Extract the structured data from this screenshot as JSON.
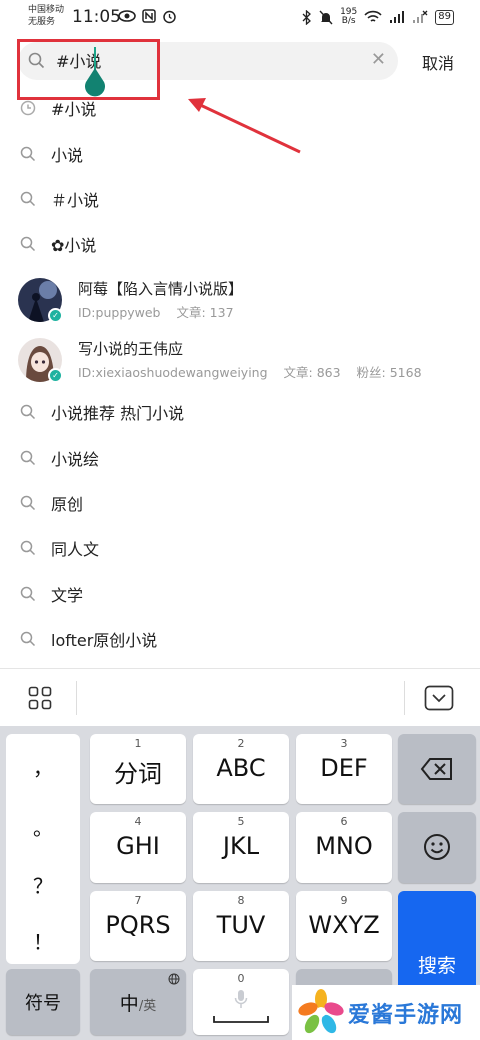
{
  "status_bar": {
    "carrier_line1": "中国移动",
    "carrier_line2": "无服务",
    "time": "11:05",
    "net_speed_value": "195",
    "net_speed_unit": "B/s",
    "battery": "89"
  },
  "search": {
    "value": "#小说",
    "cancel_label": "取消"
  },
  "suggestions_top": [
    {
      "icon": "history-icon",
      "text": "#小说"
    },
    {
      "icon": "search-icon",
      "text": "小说"
    },
    {
      "icon": "search-icon",
      "text": "＃小说"
    },
    {
      "icon": "search-icon",
      "text": "✿小说"
    }
  ],
  "users": [
    {
      "name": "阿莓【陷入言情小说版】",
      "id": "ID:puppyweb",
      "articles": "文章: 137",
      "fans": ""
    },
    {
      "name": "写小说的王伟应",
      "id": "ID:xiexiaoshuodewangweiying",
      "articles": "文章: 863",
      "fans": "粉丝: 5168"
    }
  ],
  "suggestions_bottom": [
    {
      "icon": "search-icon",
      "text": "小说推荐 热门小说"
    },
    {
      "icon": "search-icon",
      "text": "小说绘"
    },
    {
      "icon": "search-icon",
      "text": "原创"
    },
    {
      "icon": "search-icon",
      "text": "同人文"
    },
    {
      "icon": "search-icon",
      "text": "文学"
    },
    {
      "icon": "search-icon",
      "text": "lofter原创小说"
    }
  ],
  "keyboard": {
    "punctuation": [
      "，",
      "。",
      "？",
      "！"
    ],
    "keys": [
      {
        "num": "1",
        "label": "分词"
      },
      {
        "num": "2",
        "label": "ABC"
      },
      {
        "num": "3",
        "label": "DEF"
      },
      {
        "num": "4",
        "label": "GHI"
      },
      {
        "num": "5",
        "label": "JKL"
      },
      {
        "num": "6",
        "label": "MNO"
      },
      {
        "num": "7",
        "label": "PQRS"
      },
      {
        "num": "8",
        "label": "TUV"
      },
      {
        "num": "9",
        "label": "WXYZ"
      }
    ],
    "symbols_label": "符号",
    "lang_label_main": "中",
    "lang_label_sub": "/英",
    "zero_num": "0",
    "search_label": "搜索"
  },
  "watermark": {
    "text": "爱酱手游网"
  },
  "colors": {
    "accent_blue": "#1667f0",
    "annotation_red": "#e0323c",
    "caret_teal": "#1aa589"
  }
}
